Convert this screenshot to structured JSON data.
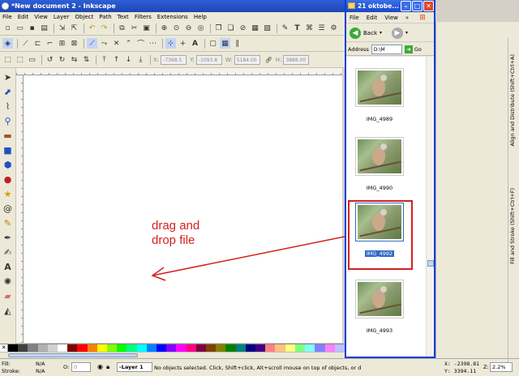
{
  "window": {
    "title": "*New document 2 - Inkscape"
  },
  "menubar": [
    "File",
    "Edit",
    "View",
    "Layer",
    "Object",
    "Path",
    "Text",
    "Filters",
    "Extensions",
    "Help"
  ],
  "coords_bar": {
    "x_label": "X:",
    "x_value": "-7368.5",
    "y_label": "Y:",
    "y_value": "-1093.8",
    "w_label": "W:",
    "w_value": "5184.00",
    "h_label": "H:",
    "h_value": "3888.00"
  },
  "annotation": {
    "line1": "drag and",
    "line2": "drop file",
    "color": "#d42020"
  },
  "statusbar": {
    "fill_label": "Fill:",
    "fill_value": "N/A",
    "stroke_label": "Stroke:",
    "stroke_value": "N/A",
    "opacity_label": "O:",
    "opacity_value": "0",
    "layer": "-Layer 1",
    "message": "No objects selected. Click, Shift+click, Alt+scroll mouse on top of objects, or d",
    "x_coord": "X: -2398.81",
    "y_coord": "Y:  3394.11",
    "zoom_label": "Z:",
    "zoom_value": "2.2%"
  },
  "dock_tabs": {
    "align": "Align and Distribute (Shift+Ctrl+A)",
    "fill_stroke": "Fill and Stroke (Shift+Ctrl+F)"
  },
  "explorer": {
    "title": "21 oktobe...",
    "menu": [
      "File",
      "Edit",
      "View"
    ],
    "back_label": "Back",
    "address_label": "Address",
    "address_value": "D:\\M",
    "go_label": "Go",
    "items": [
      {
        "name": "IMG_4989",
        "selected": false
      },
      {
        "name": "IMG_4990",
        "selected": false
      },
      {
        "name": "IMG_4992",
        "selected": true
      },
      {
        "name": "IMG_4993",
        "selected": false
      }
    ]
  },
  "palette": [
    "#000000",
    "#404040",
    "#808080",
    "#b0b0b0",
    "#d0d0d0",
    "#ffffff",
    "#800000",
    "#ff0000",
    "#ff8000",
    "#ffff00",
    "#80ff00",
    "#00ff00",
    "#00ff80",
    "#00ffff",
    "#0080ff",
    "#0000ff",
    "#8000ff",
    "#ff00ff",
    "#ff0080",
    "#800040",
    "#804000",
    "#808000",
    "#008000",
    "#008080",
    "#000080",
    "#400080",
    "#ff8080",
    "#ffc080",
    "#ffff80",
    "#80ff80",
    "#80ffff",
    "#8080ff",
    "#ff80ff",
    "#c0c0ff"
  ]
}
